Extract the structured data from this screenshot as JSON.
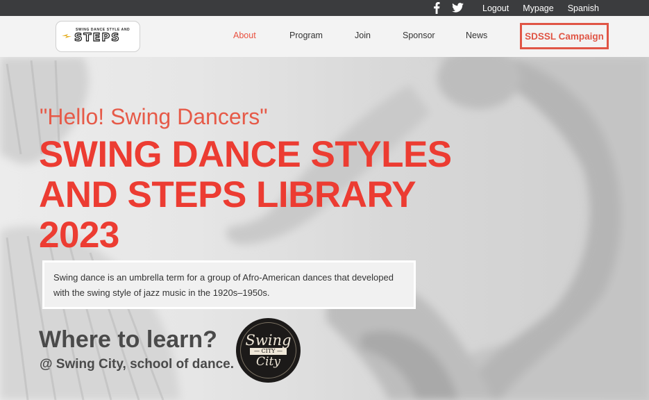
{
  "topbar": {
    "social": [
      {
        "icon": "facebook-icon",
        "glyph": "f"
      },
      {
        "icon": "twitter-icon"
      }
    ],
    "links": [
      "Logout",
      "Mypage",
      "Spanish"
    ]
  },
  "header": {
    "logo": {
      "small": "SWING DANCE STYLE AND",
      "big": "STEPS"
    },
    "nav": [
      "About",
      "Program",
      "Join",
      "Sponsor",
      "News"
    ],
    "active_nav": "About",
    "campaign": "SDSSL Campaign"
  },
  "hero": {
    "greeting": "\"Hello! Swing Dancers\"",
    "title": "SWING DANCE STYLES AND STEPS LIBRARY 2023",
    "description": "Swing dance is an umbrella term for a group of Afro-American dances that developed with the swing style of jazz music in the 1920s–1950s.",
    "learn_heading": "Where to learn?",
    "learn_place": "@ Swing City, school of dance.",
    "badge": {
      "line1": "Swing",
      "line2": "— CITY —",
      "line3": "City"
    }
  },
  "colors": {
    "accent": "#ec3c32",
    "topbar": "#3b3c3e",
    "nav_active": "#e9503f"
  }
}
